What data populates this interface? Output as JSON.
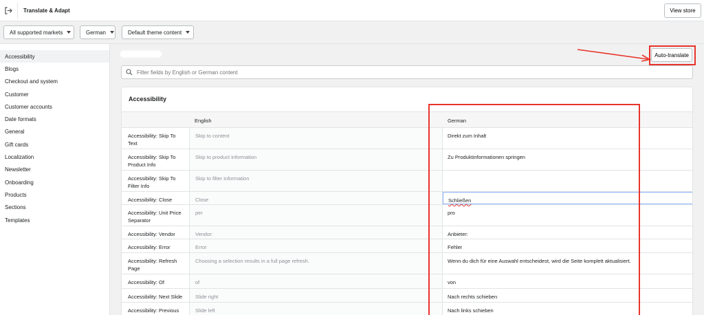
{
  "header": {
    "title": "Translate & Adapt",
    "view_store": "View store"
  },
  "filters": {
    "market": "All supported markets",
    "language": "German",
    "content": "Default theme content"
  },
  "sidebar": {
    "items": [
      {
        "label": "Accessibility"
      },
      {
        "label": "Blogs"
      },
      {
        "label": "Checkout and system"
      },
      {
        "label": "Customer"
      },
      {
        "label": "Customer accounts"
      },
      {
        "label": "Date formats"
      },
      {
        "label": "General"
      },
      {
        "label": "Gift cards"
      },
      {
        "label": "Localization"
      },
      {
        "label": "Newsletter"
      },
      {
        "label": "Onboarding"
      },
      {
        "label": "Products"
      },
      {
        "label": "Sections"
      },
      {
        "label": "Templates"
      }
    ]
  },
  "main": {
    "auto_translate": "Auto-translate",
    "search_placeholder": "Filter fields by English or German content",
    "card_title": "Accessibility",
    "columns": {
      "english": "English",
      "german": "German"
    },
    "rows": [
      {
        "key": "Accessibility: Skip To Text",
        "en": "Skip to content",
        "de": "Direkt zum Inhalt"
      },
      {
        "key": "Accessibility: Skip To Product Info",
        "en": "Skip to product information",
        "de": "Zu Produktinformationen springen"
      },
      {
        "key": "Accessibility: Skip To Filter Info",
        "en": "Skip to filter information",
        "de": ""
      },
      {
        "key": "Accessibility: Close",
        "en": "Close",
        "de": "Schließen"
      },
      {
        "key": "Accessibility: Unit Price Separator",
        "en": "per",
        "de": "pro"
      },
      {
        "key": "Accessibility: Vendor",
        "en": "Vendor:",
        "de": "Anbieter:"
      },
      {
        "key": "Accessibility: Error",
        "en": "Error",
        "de": "Fehler"
      },
      {
        "key": "Accessibility: Refresh Page",
        "en": "Choosing a selection results in a full page refresh.",
        "de": "Wenn du dich für eine Auswahl entscheidest, wird die Seite komplett aktualisiert."
      },
      {
        "key": "Accessibility: Of",
        "en": "of",
        "de": "von"
      },
      {
        "key": "Accessibility: Next Slide",
        "en": "Slide right",
        "de": "Nach rechts schieben"
      },
      {
        "key": "Accessibility: Previous Slide",
        "en": "Slide left",
        "de": "Nach links schieben"
      }
    ]
  },
  "colors": {
    "annotation": "#e8332a",
    "focus": "#8ab4f8"
  },
  "icons": {
    "exit": "exit-icon",
    "search": "search-icon",
    "caret": "chevron-down-icon"
  }
}
